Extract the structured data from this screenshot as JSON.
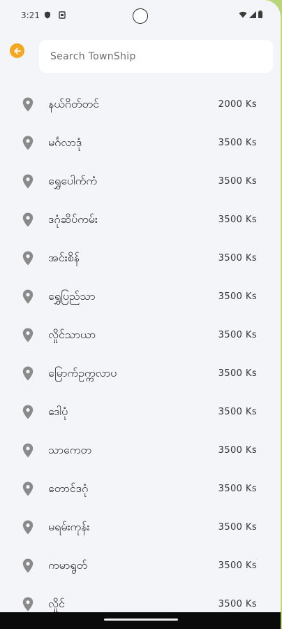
{
  "status": {
    "time": "3:21",
    "icons": [
      "shield-icon",
      "notification-icon",
      "wifi-icon",
      "signal-icon",
      "battery-icon"
    ]
  },
  "header": {
    "back_icon": "back-arrow-icon",
    "back_color": "#f3a81f",
    "search_placeholder": "Search TownShip",
    "search_value": ""
  },
  "townships": [
    {
      "name": "နယ်ဂိတ်တင်",
      "price": "2000 Ks"
    },
    {
      "name": "မင်္ဂလာဒုံ",
      "price": "3500 Ks"
    },
    {
      "name": "ရွှေပေါက်ကံ",
      "price": "3500 Ks"
    },
    {
      "name": "ဒဂုံဆိပ်ကမ်း",
      "price": "3500 Ks"
    },
    {
      "name": "အင်းစိန်",
      "price": "3500 Ks"
    },
    {
      "name": "ရွှေပြည်သာ",
      "price": "3500 Ks"
    },
    {
      "name": "လှိုင်သာယာ",
      "price": "3500 Ks"
    },
    {
      "name": "မြောက်ဥက္ကလာပ",
      "price": "3500 Ks"
    },
    {
      "name": "ဒေါပုံ",
      "price": "3500 Ks"
    },
    {
      "name": "သာကေတ",
      "price": "3500 Ks"
    },
    {
      "name": "တောင်ဒဂုံ",
      "price": "3500 Ks"
    },
    {
      "name": "မရမ်းကုန်း",
      "price": "3500 Ks"
    },
    {
      "name": "ကမာရွတ်",
      "price": "3500 Ks"
    },
    {
      "name": "လှိုင်",
      "price": "3500 Ks"
    }
  ],
  "colors": {
    "background": "#f4f5f8",
    "pin": "#8a8a8a",
    "accent": "#f3a81f"
  }
}
